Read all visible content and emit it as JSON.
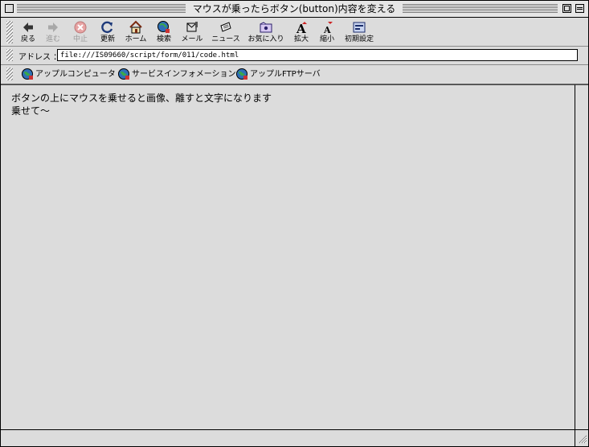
{
  "window": {
    "title": "マウスが乗ったらボタン(button)内容を変える"
  },
  "toolbar": {
    "buttons": [
      {
        "label": "戻る",
        "icon": "back-arrow-icon",
        "enabled": true
      },
      {
        "label": "進む",
        "icon": "forward-arrow-icon",
        "enabled": false
      },
      {
        "label": "中止",
        "icon": "stop-icon",
        "enabled": false
      },
      {
        "label": "更新",
        "icon": "refresh-icon",
        "enabled": true
      },
      {
        "label": "ホーム",
        "icon": "home-icon",
        "enabled": true
      },
      {
        "label": "検索",
        "icon": "search-globe-icon",
        "enabled": true
      },
      {
        "label": "メール",
        "icon": "mail-icon",
        "enabled": true
      },
      {
        "label": "ニュース",
        "icon": "news-icon",
        "enabled": true
      },
      {
        "label": "お気に入り",
        "icon": "favorites-icon",
        "enabled": true
      },
      {
        "label": "拡大",
        "icon": "font-larger-icon",
        "enabled": true
      },
      {
        "label": "縮小",
        "icon": "font-smaller-icon",
        "enabled": true
      },
      {
        "label": "初期設定",
        "icon": "preferences-icon",
        "enabled": true
      }
    ]
  },
  "address": {
    "label": "アドレス ：",
    "value": "file:///IS09660/script/form/011/code.html"
  },
  "links": [
    {
      "label": "アップルコンピュータ",
      "icon": "globe-icon"
    },
    {
      "label": "サービスインフォメーション",
      "icon": "globe-icon"
    },
    {
      "label": "アップルFTPサーバ",
      "icon": "globe-icon"
    }
  ],
  "content": {
    "description": "ボタンの上にマウスを乗せると画像、離すと文字になります",
    "button_label": "乗せて〜"
  },
  "colors": {
    "window_bg": "#dcdcdc",
    "title_bg": "#e6e6e6",
    "disabled_text": "#9a9a9a"
  }
}
